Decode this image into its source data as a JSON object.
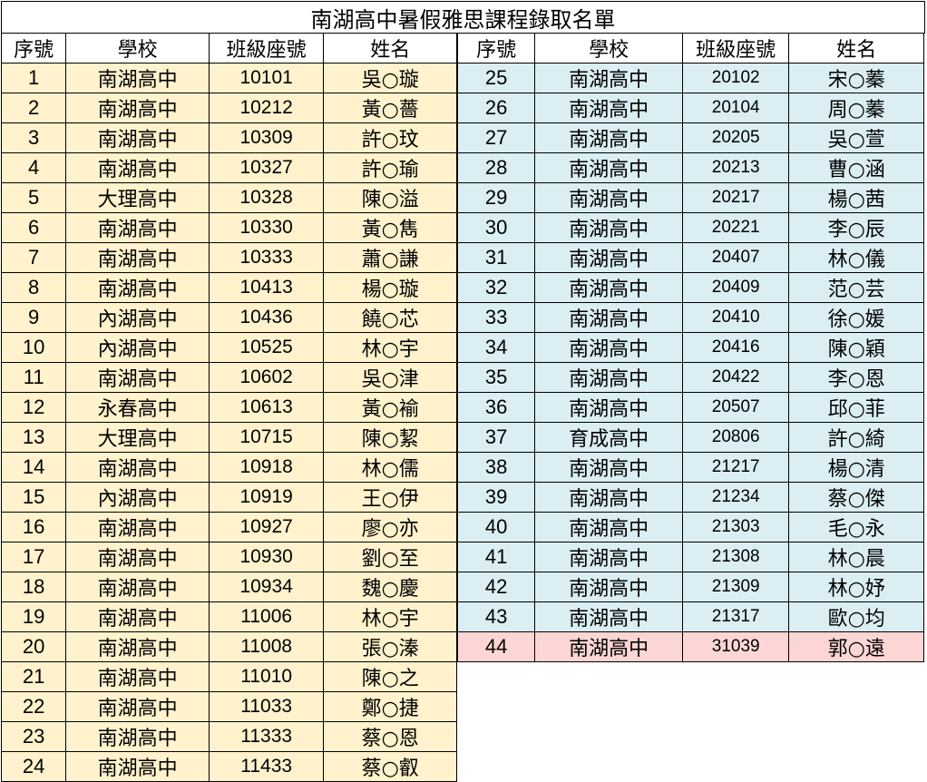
{
  "title": "南湖高中暑假雅思課程錄取名單",
  "headers": [
    "序號",
    "學校",
    "班級座號",
    "姓名"
  ],
  "colors": {
    "left_fill": "#FFF2CC",
    "right_fill": "#DAEEF3",
    "highlight_fill": "#FCD5D5"
  },
  "left_rows": [
    {
      "no": "1",
      "school": "南湖高中",
      "cls": "10101",
      "name": "吳○璇"
    },
    {
      "no": "2",
      "school": "南湖高中",
      "cls": "10212",
      "name": "黃○薔"
    },
    {
      "no": "3",
      "school": "南湖高中",
      "cls": "10309",
      "name": "許○玟"
    },
    {
      "no": "4",
      "school": "南湖高中",
      "cls": "10327",
      "name": "許○瑜"
    },
    {
      "no": "5",
      "school": "大理高中",
      "cls": "10328",
      "name": "陳○溢"
    },
    {
      "no": "6",
      "school": "南湖高中",
      "cls": "10330",
      "name": "黃○雋"
    },
    {
      "no": "7",
      "school": "南湖高中",
      "cls": "10333",
      "name": "蕭○謙"
    },
    {
      "no": "8",
      "school": "南湖高中",
      "cls": "10413",
      "name": "楊○璇"
    },
    {
      "no": "9",
      "school": "內湖高中",
      "cls": "10436",
      "name": "饒○芯"
    },
    {
      "no": "10",
      "school": "內湖高中",
      "cls": "10525",
      "name": "林○宇"
    },
    {
      "no": "11",
      "school": "南湖高中",
      "cls": "10602",
      "name": "吳○津"
    },
    {
      "no": "12",
      "school": "永春高中",
      "cls": "10613",
      "name": "黃○褕"
    },
    {
      "no": "13",
      "school": "大理高中",
      "cls": "10715",
      "name": "陳○絜"
    },
    {
      "no": "14",
      "school": "南湖高中",
      "cls": "10918",
      "name": "林○儒"
    },
    {
      "no": "15",
      "school": "內湖高中",
      "cls": "10919",
      "name": "王○伊"
    },
    {
      "no": "16",
      "school": "南湖高中",
      "cls": "10927",
      "name": "廖○亦"
    },
    {
      "no": "17",
      "school": "南湖高中",
      "cls": "10930",
      "name": "劉○至"
    },
    {
      "no": "18",
      "school": "南湖高中",
      "cls": "10934",
      "name": "魏○慶"
    },
    {
      "no": "19",
      "school": "南湖高中",
      "cls": "11006",
      "name": "林○宇"
    },
    {
      "no": "20",
      "school": "南湖高中",
      "cls": "11008",
      "name": "張○溱"
    },
    {
      "no": "21",
      "school": "南湖高中",
      "cls": "11010",
      "name": "陳○之"
    },
    {
      "no": "22",
      "school": "南湖高中",
      "cls": "11033",
      "name": "鄭○捷"
    },
    {
      "no": "23",
      "school": "南湖高中",
      "cls": "11333",
      "name": "蔡○恩"
    },
    {
      "no": "24",
      "school": "南湖高中",
      "cls": "11433",
      "name": "蔡○叡"
    }
  ],
  "right_rows": [
    {
      "no": "25",
      "school": "南湖高中",
      "cls": "20102",
      "name": "宋○蓁"
    },
    {
      "no": "26",
      "school": "南湖高中",
      "cls": "20104",
      "name": "周○蓁"
    },
    {
      "no": "27",
      "school": "南湖高中",
      "cls": "20205",
      "name": "吳○萱"
    },
    {
      "no": "28",
      "school": "南湖高中",
      "cls": "20213",
      "name": "曹○涵"
    },
    {
      "no": "29",
      "school": "南湖高中",
      "cls": "20217",
      "name": "楊○茜"
    },
    {
      "no": "30",
      "school": "南湖高中",
      "cls": "20221",
      "name": "李○辰"
    },
    {
      "no": "31",
      "school": "南湖高中",
      "cls": "20407",
      "name": "林○儀"
    },
    {
      "no": "32",
      "school": "南湖高中",
      "cls": "20409",
      "name": "范○芸"
    },
    {
      "no": "33",
      "school": "南湖高中",
      "cls": "20410",
      "name": "徐○媛"
    },
    {
      "no": "34",
      "school": "南湖高中",
      "cls": "20416",
      "name": "陳○穎"
    },
    {
      "no": "35",
      "school": "南湖高中",
      "cls": "20422",
      "name": "李○恩"
    },
    {
      "no": "36",
      "school": "南湖高中",
      "cls": "20507",
      "name": "邱○菲"
    },
    {
      "no": "37",
      "school": "育成高中",
      "cls": "20806",
      "name": "許○綺"
    },
    {
      "no": "38",
      "school": "南湖高中",
      "cls": "21217",
      "name": "楊○清"
    },
    {
      "no": "39",
      "school": "南湖高中",
      "cls": "21234",
      "name": "蔡○傑"
    },
    {
      "no": "40",
      "school": "南湖高中",
      "cls": "21303",
      "name": "毛○永"
    },
    {
      "no": "41",
      "school": "南湖高中",
      "cls": "21308",
      "name": "林○晨"
    },
    {
      "no": "42",
      "school": "南湖高中",
      "cls": "21309",
      "name": "林○妤"
    },
    {
      "no": "43",
      "school": "南湖高中",
      "cls": "21317",
      "name": "歐○均"
    },
    {
      "no": "44",
      "school": "南湖高中",
      "cls": "31039",
      "name": "郭○遠",
      "highlight": true
    }
  ]
}
